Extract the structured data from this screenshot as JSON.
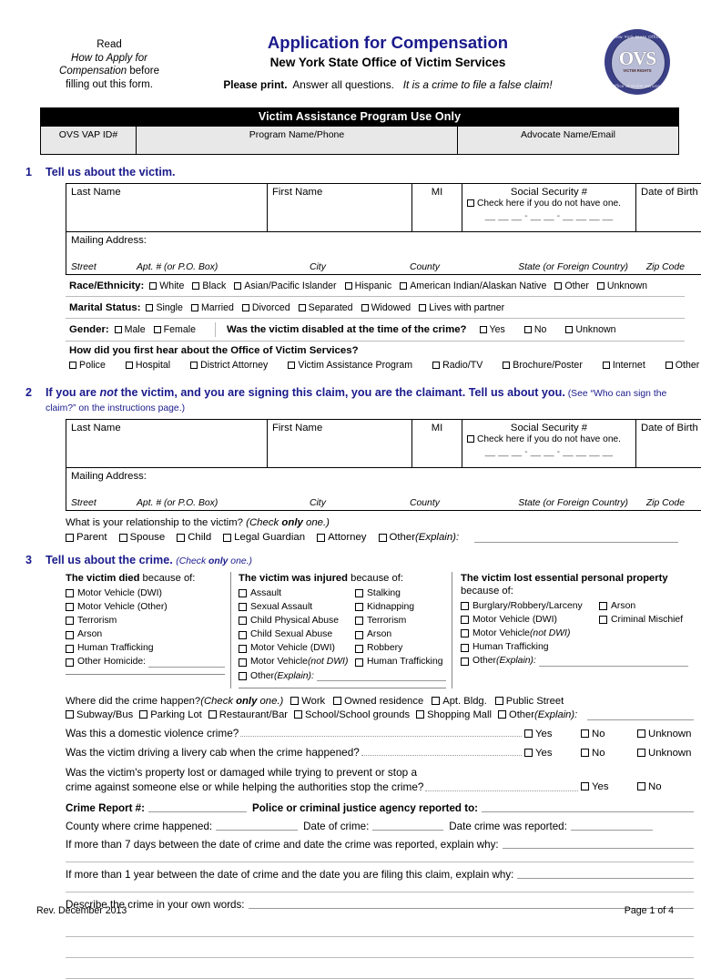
{
  "header": {
    "left_note_line1": "Read",
    "left_note_line2": "How to Apply for",
    "left_note_line3": "Compensation",
    "left_note_line3_tail": " before",
    "left_note_line4": "filling out this form.",
    "title": "Application for Compensation",
    "subtitle": "New York State Office of Victim Services",
    "please_print": "Please print.",
    "answer_all": "Answer all questions.",
    "false_claim": "It is a crime to file a false claim!",
    "title_color": "#1a1a8c",
    "seal": {
      "center_text": "OVS",
      "top_text": "New York State Office",
      "bottom_text": "Office of Victim Services",
      "mid_text": "VICTIM RIGHTS"
    }
  },
  "vap": {
    "title": "Victim Assistance Program Use Only",
    "col1": "OVS VAP ID#",
    "col2": "Program Name/Phone",
    "col3": "Advocate Name/Email"
  },
  "section1": {
    "number": "1",
    "heading": "Tell us about the victim.",
    "name_table": {
      "last_name": "Last Name",
      "first_name": "First Name",
      "mi": "MI",
      "ssn": "Social Security #",
      "ssn_check": "Check here if you do not have one.",
      "ssn_digits": "__ __ __ - __ __ - __ __ __ __",
      "dob": "Date of Birth",
      "mailing_address": "Mailing Address:",
      "sub_street": "Street",
      "sub_apt": "Apt. # (or P.O. Box)",
      "sub_city": "City",
      "sub_county": "County",
      "sub_state": "State  (or Foreign Country)",
      "sub_zip": "Zip Code"
    },
    "race_label": "Race/Ethnicity:",
    "race_options": [
      "White",
      "Black",
      "Asian/Pacific Islander",
      "Hispanic",
      "American Indian/Alaskan Native",
      "Other",
      "Unknown"
    ],
    "marital_label": "Marital Status:",
    "marital_options": [
      "Single",
      "Married",
      "Divorced",
      "Separated",
      "Widowed",
      "Lives with partner"
    ],
    "gender_label": "Gender:",
    "gender_options": [
      "Male",
      "Female"
    ],
    "disabled_question": "Was the victim disabled at the time of the crime?",
    "disabled_options": [
      "Yes",
      "No",
      "Unknown"
    ],
    "hear_question": "How did you first hear about the Office of Victim Services?",
    "hear_options": [
      "Police",
      "Hospital",
      "District Attorney",
      "Victim Assistance Program",
      "Radio/TV",
      "Brochure/Poster",
      "Internet",
      "Other"
    ]
  },
  "section2": {
    "number": "2",
    "heading_part1": "If you are ",
    "heading_not": "not",
    "heading_part2": " the victim, and you are signing this claim, you are the claimant.  Tell us about you.",
    "heading_paren": " (See “Who can sign the claim?” on the instructions page.)",
    "relationship_question": "What is your relationship to the victim? ",
    "relationship_check": "(Check ",
    "relationship_only": "only",
    "relationship_one": " one.)",
    "relationship_options": [
      "Parent",
      "Spouse",
      "Child",
      "Legal Guardian",
      "Attorney"
    ],
    "relationship_other": "Other",
    "relationship_explain": " (Explain):"
  },
  "section3": {
    "number": "3",
    "heading": "Tell us about the crime.",
    "heading_check": "(Check ",
    "heading_only": "only",
    "heading_one": " one.)",
    "died": {
      "title_bold": "The victim died",
      "title_rest": " because of:",
      "options": [
        "Motor Vehicle (DWI)",
        "Motor Vehicle (Other)",
        "Terrorism",
        "Arson",
        "Human Trafficking"
      ],
      "last_option": "Other Homicide:"
    },
    "injured": {
      "title_bold": "The victim was injured",
      "title_rest": " because of:",
      "col_left": [
        "Assault",
        "Sexual Assault",
        "Child Physical Abuse",
        "Child Sexual Abuse",
        "Motor Vehicle (DWI)"
      ],
      "col_left_italic_label": "Motor Vehicle ",
      "col_left_italic": "(not DWI)",
      "col_right": [
        "Stalking",
        "Kidnapping",
        "Terrorism",
        "Arson",
        "Robbery",
        "Human Trafficking"
      ],
      "other_label": "Other ",
      "other_italic": "(Explain):"
    },
    "property": {
      "title_bold": "The victim lost essential personal property",
      "title_rest": "because of:",
      "col_left": [
        "Burglary/Robbery/Larceny",
        "Motor Vehicle (DWI)"
      ],
      "col_left_italic_label": "Motor Vehicle ",
      "col_left_italic": "(not DWI)",
      "col_left_more": [
        "Human Trafficking"
      ],
      "col_right": [
        "Arson",
        "Criminal Mischief"
      ],
      "other_label": "Other ",
      "other_italic": "(Explain):"
    },
    "where_question": "Where did the crime happen? ",
    "where_check": "(Check ",
    "where_only": "only",
    "where_one": " one.)",
    "where_options_row1": [
      "Work",
      "Owned residence",
      "Apt. Bldg.",
      "Public Street"
    ],
    "where_options_row2": [
      "Subway/Bus",
      "Parking Lot",
      "Restaurant/Bar",
      "School/School grounds",
      "Shopping Mall"
    ],
    "where_other": "Other",
    "where_other_explain": " (Explain):",
    "dv_question": "Was this a domestic violence crime?",
    "dv_options": [
      "Yes",
      "No",
      "Unknown"
    ],
    "livery_question": "Was the victim driving a livery cab when the crime happened?",
    "livery_options": [
      "Yes",
      "No",
      "Unknown"
    ],
    "property_q_line1": "Was the victim's property lost or damaged while trying to prevent or stop a",
    "property_q_line2": "crime against someone else or while helping the authorities stop the crime?",
    "property_q_options": [
      "Yes",
      "No"
    ],
    "crime_report_label": "Crime Report #:",
    "agency_label": "Police or criminal justice agency reported to:",
    "county_label": "County where crime happened:",
    "date_of_crime_label": "Date of crime:",
    "date_reported_label": "Date crime was reported:",
    "explain_7days": "If more than 7 days between the date of crime and date the crime was reported, explain why:",
    "explain_1year": "If more than 1 year between the date of crime and the date you are filing this claim, explain why:",
    "describe_label": "Describe the crime in your own words:"
  },
  "footer": {
    "revision": "Rev. December 2013",
    "page": "Page 1 of 4"
  }
}
